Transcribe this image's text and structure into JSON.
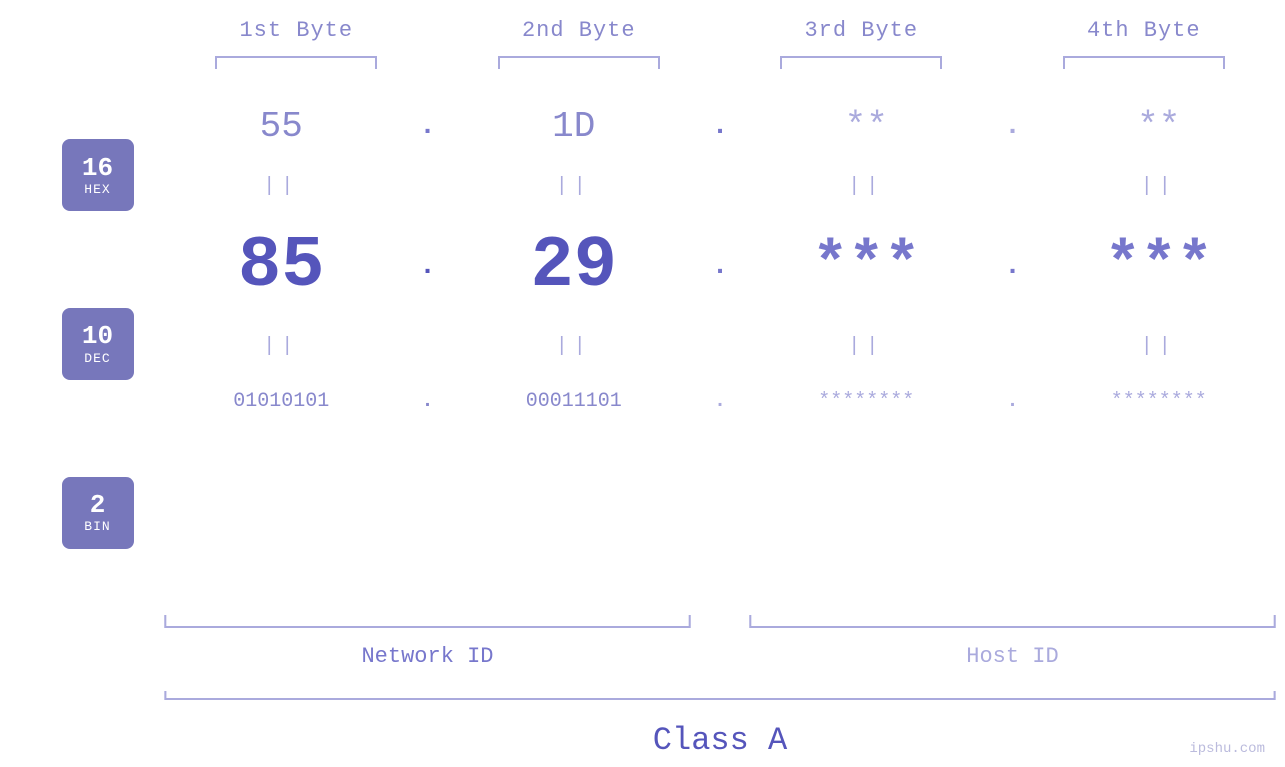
{
  "bytes": {
    "labels": [
      "1st Byte",
      "2nd Byte",
      "3rd Byte",
      "4th Byte"
    ]
  },
  "badges": [
    {
      "num": "16",
      "label": "HEX"
    },
    {
      "num": "10",
      "label": "DEC"
    },
    {
      "num": "2",
      "label": "BIN"
    }
  ],
  "hex_row": {
    "values": [
      "55",
      "1D",
      "**",
      "**"
    ],
    "dots": [
      ".",
      ".",
      ".",
      ""
    ]
  },
  "dec_row": {
    "values": [
      "85",
      "29",
      "***",
      "***"
    ],
    "dots": [
      ".",
      ".",
      ".",
      ""
    ]
  },
  "bin_row": {
    "values": [
      "01010101",
      "00011101",
      "********",
      "********"
    ],
    "dots": [
      ".",
      ".",
      ".",
      ""
    ]
  },
  "labels": {
    "network_id": "Network ID",
    "host_id": "Host ID",
    "class": "Class A"
  },
  "watermark": "ipshu.com",
  "eq_symbol": "||"
}
